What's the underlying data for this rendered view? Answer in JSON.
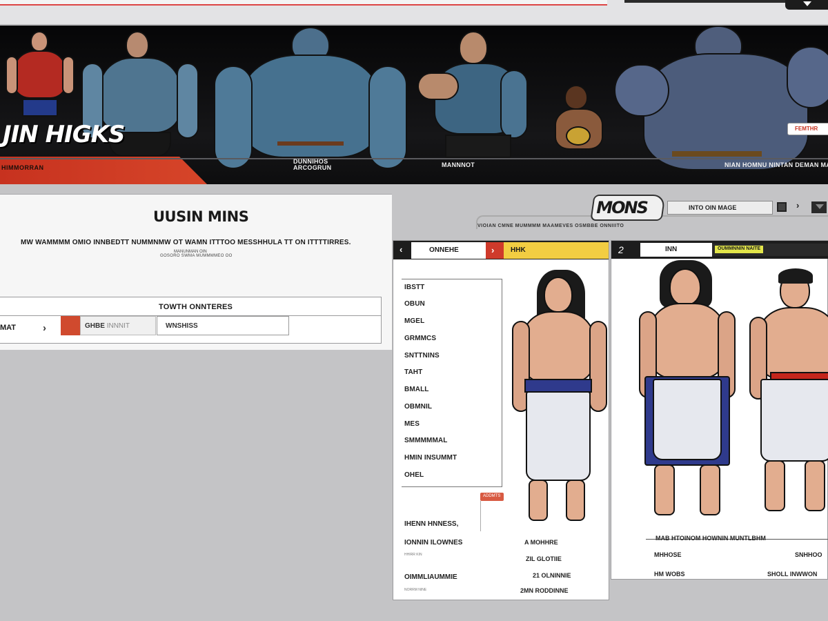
{
  "banner": {
    "title": "JIN HIGKS",
    "tag": "HIMMORRAN",
    "badge": "FEMTHR",
    "captions": [
      "DUNNIHOS\nARCOGRUN",
      "MANNNOT",
      "NIAN HOMNU NINTAN DEMAN MANMOL"
    ]
  },
  "left_panel": {
    "heading": "UUSIN MINS",
    "description": "MW WAMMMM OMIO INNBEDTT NUMMNMW OT WAMN ITTTOO MESSHHULA TT ON ITTTTIRRES.",
    "subdesc_top": "MANUNMAN OIN",
    "subdesc": "GOSORO SWMA MUMMMMEO OO",
    "filter": {
      "title": "TOWTH ONNTERES",
      "label": "MAT",
      "chevron": "›",
      "input_value": "GHBE",
      "input_placeholder": "INNNIT",
      "second_input": "WNSHISS"
    }
  },
  "right_header": {
    "logo": "MONS",
    "search": "INTO OIN MAGE",
    "chevron": "›",
    "sub": "VIOIAN CMNE MUMMMM MAAMEVES OSMBBE ONNIIITO"
  },
  "char_panel": {
    "tabs": {
      "back": "‹",
      "active": "ONNEHE",
      "red": "›",
      "yellow": "HHK"
    },
    "stats": [
      "IBSTT",
      "OBUN",
      "MGEL",
      "GRMMCS",
      "SNTTNINS",
      "TAHT",
      "BMALL",
      "OBMNIL",
      "MES",
      "SMMMMMAL",
      "HMIN INSUMMT",
      "OHEL"
    ],
    "tag": "ADDMTS",
    "bottom": [
      {
        "label": "IHENN HNNESS,",
        "small": ""
      },
      {
        "label": "IONNIN ILOWNES",
        "small": "HHIRR KIN"
      },
      {
        "label": "OIMMLIAUMMIE",
        "small": "NORRM NINE"
      }
    ],
    "bottom_right": [
      "A MOHHRE",
      "ZIL GLOTIIE",
      "21 OLNINNIE",
      "2MN RODDINNE"
    ]
  },
  "comp_panel": {
    "number": "2",
    "tab_white": "INN",
    "tab_yellow": "OUMMNNIN NAITE",
    "labels": [
      "MAB HTOINOM HOWNIN MUNTLBHM",
      "MHHOSE",
      "SNHHOO",
      "HM WOBS",
      "SHOLL INWWON"
    ]
  },
  "colors": {
    "accent_red": "#cf3a2b",
    "accent_yellow": "#f2cd42",
    "dark": "#1d1d1d",
    "panel_bg": "#ffffff",
    "page_bg": "#c4c4c6"
  }
}
